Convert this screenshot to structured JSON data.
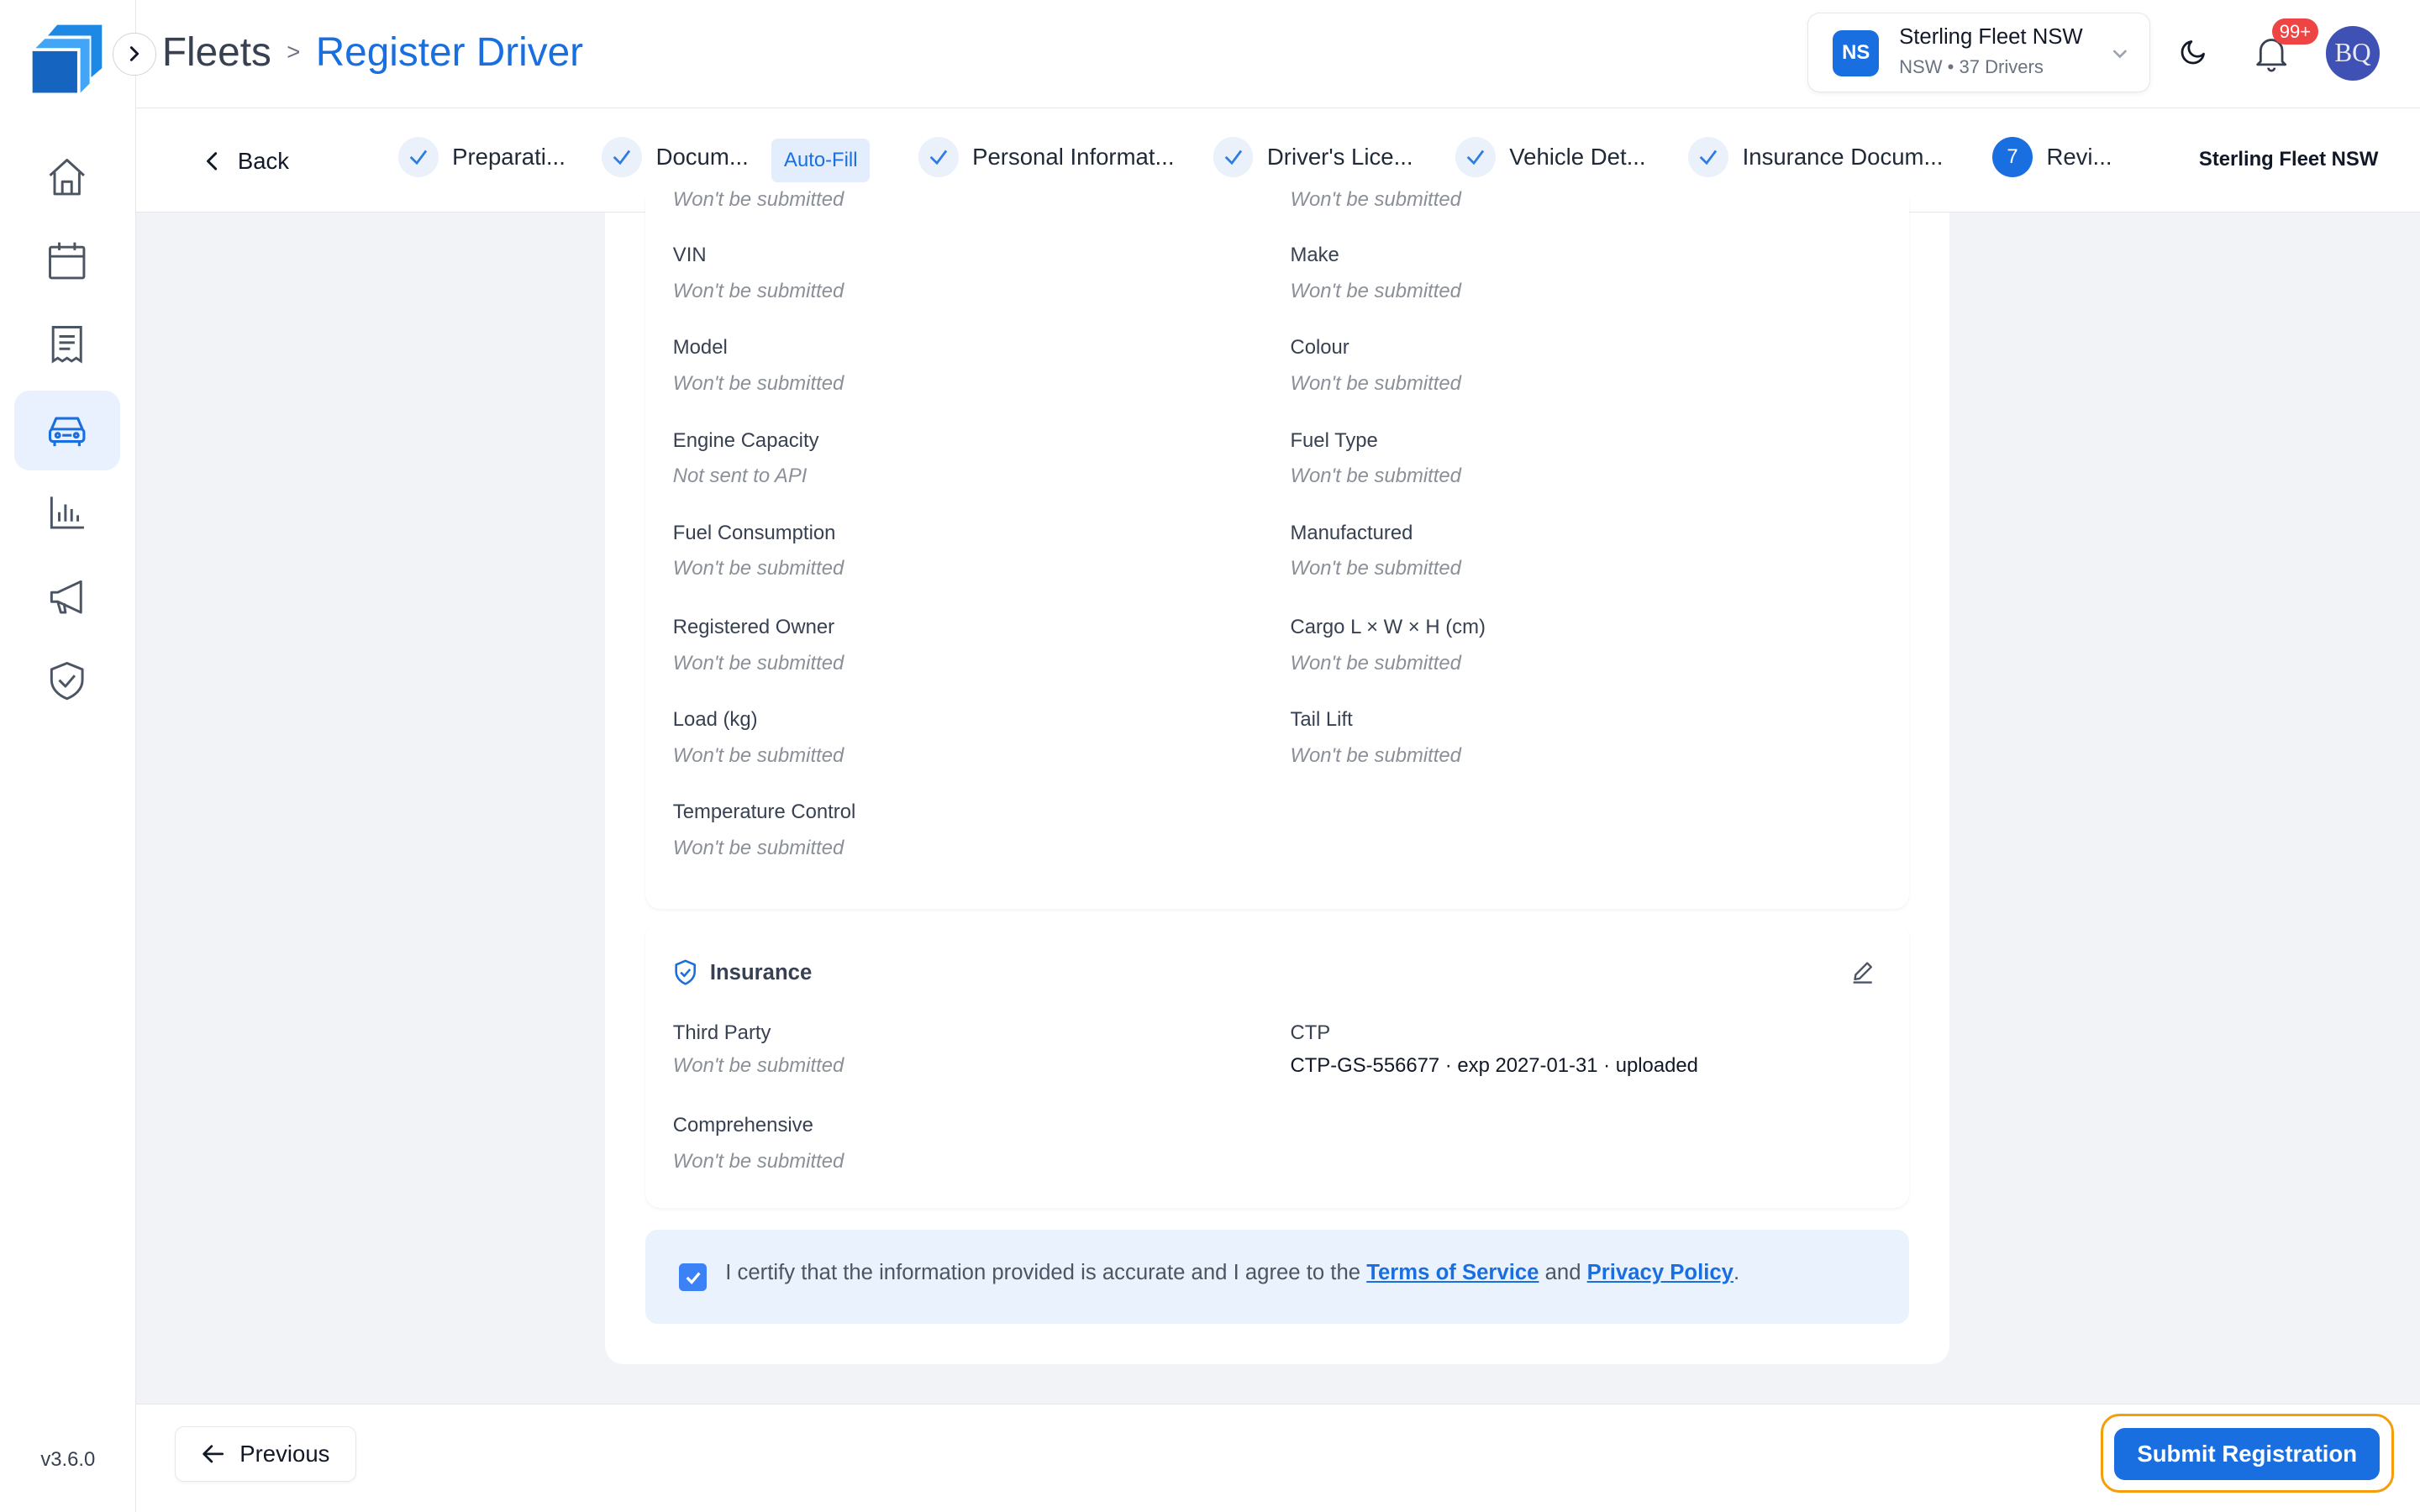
{
  "app": {
    "version": "v3.6.0"
  },
  "header": {
    "breadcrumb_root": "Fleets",
    "breadcrumb_separator": ">",
    "page_title": "Register Driver",
    "org": {
      "badge": "NS",
      "name": "Sterling Fleet NSW",
      "subtitle": "NSW • 37 Drivers"
    },
    "notifications_count": "99+",
    "avatar_initials": "BQ"
  },
  "sidebar": {
    "items": [
      {
        "icon": "home-icon",
        "active": false
      },
      {
        "icon": "calendar-icon",
        "active": false
      },
      {
        "icon": "document-list-icon",
        "active": false
      },
      {
        "icon": "car-icon",
        "active": true
      },
      {
        "icon": "bar-chart-icon",
        "active": false
      },
      {
        "icon": "megaphone-icon",
        "active": false
      },
      {
        "icon": "shield-check-icon",
        "active": false
      }
    ]
  },
  "stepper": {
    "back_label": "Back",
    "autofill_label": "Auto-Fill",
    "org_label": "Sterling Fleet NSW",
    "steps": [
      {
        "label": "Preparati...",
        "status": "done"
      },
      {
        "label": "Docum...",
        "status": "done"
      },
      {
        "label": "Personal Informat...",
        "status": "done"
      },
      {
        "label": "Driver's Lice...",
        "status": "done"
      },
      {
        "label": "Vehicle Det...",
        "status": "done"
      },
      {
        "label": "Insurance Docum...",
        "status": "done"
      },
      {
        "label": "Revi...",
        "status": "current",
        "number": "7"
      }
    ]
  },
  "vehicle_section": {
    "partial_values": [
      "Won't be submitted",
      "Won't be submitted"
    ],
    "fields": [
      {
        "label": "VIN",
        "value": "Won't be submitted"
      },
      {
        "label": "Make",
        "value": "Won't be submitted"
      },
      {
        "label": "Model",
        "value": "Won't be submitted"
      },
      {
        "label": "Colour",
        "value": "Won't be submitted"
      },
      {
        "label": "Engine Capacity",
        "value": "Not sent to API"
      },
      {
        "label": "Fuel Type",
        "value": "Won't be submitted"
      },
      {
        "label": "Fuel Consumption",
        "value": "Won't be submitted"
      },
      {
        "label": "Manufactured",
        "value": "Won't be submitted"
      },
      {
        "label": "Registered Owner",
        "value": "Won't be submitted"
      },
      {
        "label": "Cargo L × W × H (cm)",
        "value": "Won't be submitted"
      },
      {
        "label": "Load (kg)",
        "value": "Won't be submitted"
      },
      {
        "label": "Tail Lift",
        "value": "Won't be submitted"
      },
      {
        "label": "Temperature Control",
        "value": "Won't be submitted"
      }
    ]
  },
  "insurance_section": {
    "title": "Insurance",
    "fields": [
      {
        "label": "Third Party",
        "value": "Won't be submitted"
      },
      {
        "label": "CTP",
        "value": "CTP-GS-556677 · exp 2027-01-31 · uploaded"
      },
      {
        "label": "Comprehensive",
        "value": "Won't be submitted"
      }
    ]
  },
  "certify": {
    "checked": true,
    "text_before": "I certify that the information provided is accurate and I agree to the",
    "terms_link": "Terms of Service",
    "text_and": "and",
    "privacy_link": "Privacy Policy",
    "text_end": "."
  },
  "footer": {
    "previous_label": "Previous",
    "submit_label": "Submit Registration"
  },
  "colors": {
    "accent": "#1a6fe0",
    "highlight_ring": "#f59e0b",
    "notification": "#ef4444"
  }
}
